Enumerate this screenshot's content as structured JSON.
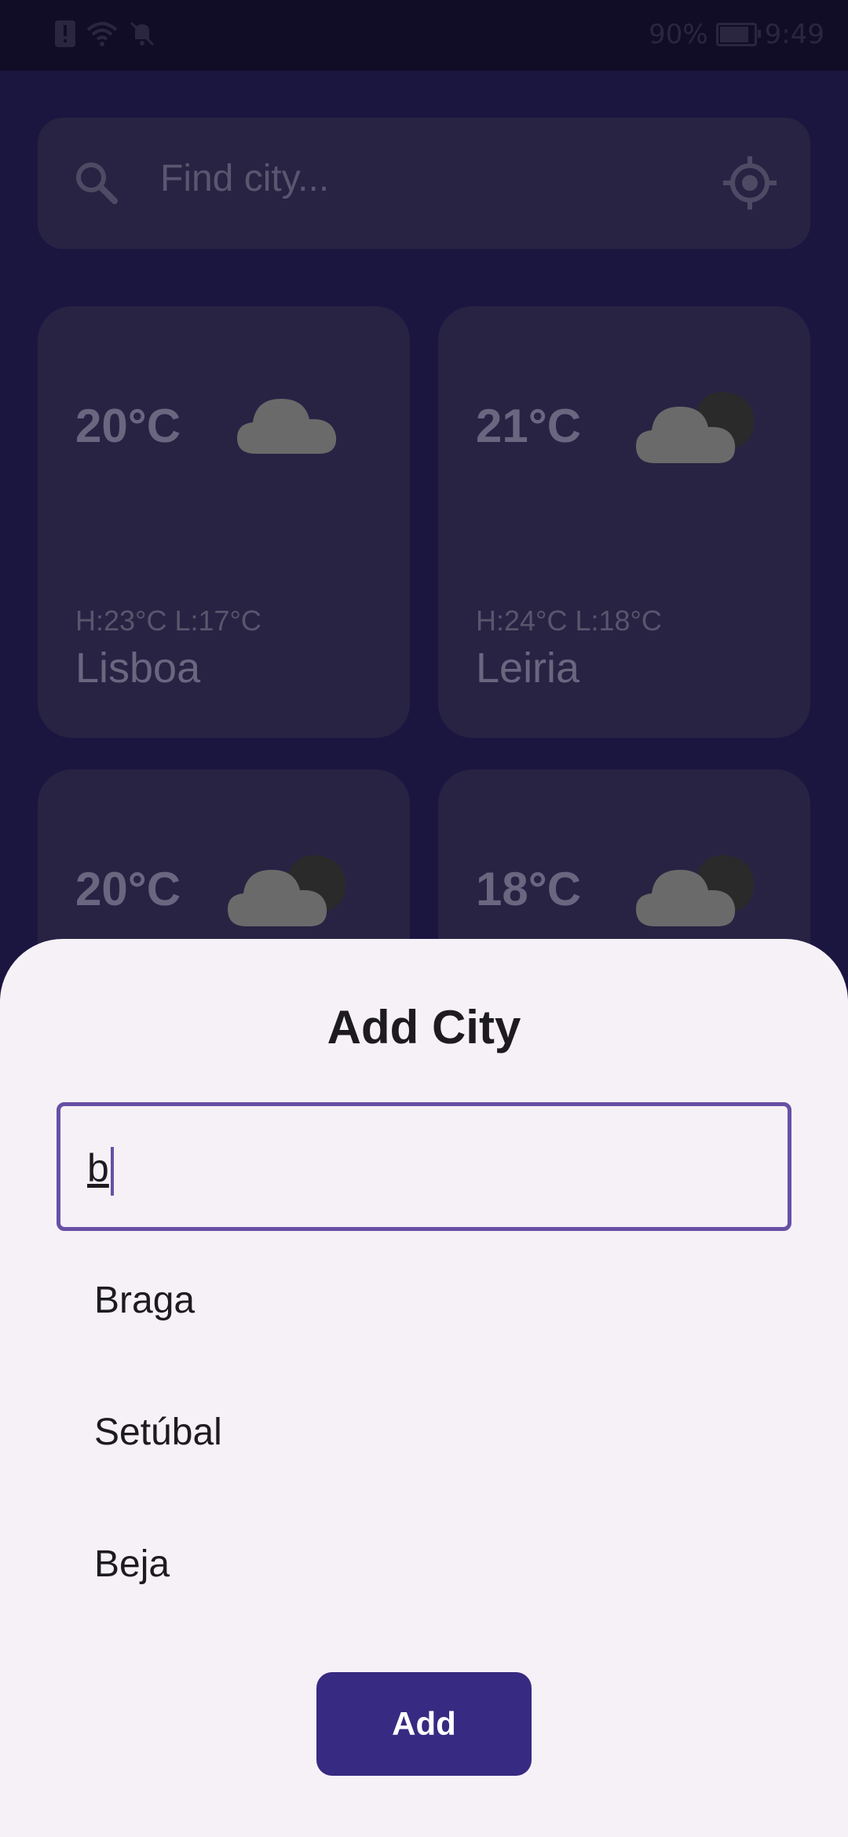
{
  "status_bar": {
    "battery": "90%",
    "time": "9:49",
    "icons": [
      "alert-icon",
      "wifi-icon",
      "bell-off-icon",
      "battery-icon"
    ],
    "battery_level": 0.9
  },
  "search": {
    "placeholder": "Find city...",
    "icon": "search-icon",
    "location_icon": "my-location-icon"
  },
  "cards": [
    {
      "temp": "20°C",
      "high_low": "H:23°C  L:17°C",
      "city": "Lisboa",
      "icon": "cloud-icon"
    },
    {
      "temp": "21°C",
      "high_low": "H:24°C  L:18°C",
      "city": "Leiria",
      "icon": "cloud-night-icon"
    },
    {
      "temp": "20°C",
      "icon": "cloud-night-icon"
    },
    {
      "temp": "18°C",
      "icon": "cloud-night-icon"
    }
  ],
  "dialog": {
    "title": "Add City",
    "input_value": "b",
    "suggestions": [
      "Braga",
      "Setúbal",
      "Beja"
    ],
    "add_label": "Add"
  },
  "colors": {
    "background": "#1b1640",
    "card": "#282343",
    "sheet": "#f6f1f7",
    "accent": "#6750a4",
    "button": "#372a82"
  }
}
